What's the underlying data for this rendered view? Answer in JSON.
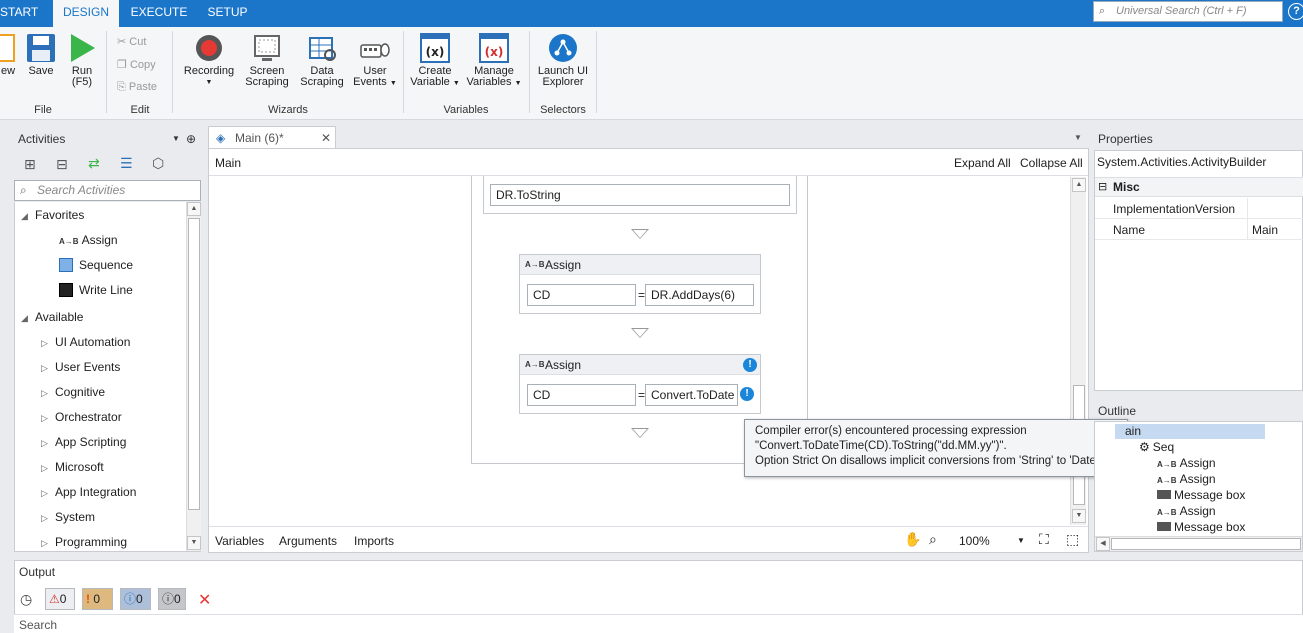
{
  "ribbon_tabs": [
    "START",
    "DESIGN",
    "EXECUTE",
    "SETUP"
  ],
  "universal_search": "Universal Search (Ctrl + F)",
  "ribbon": {
    "new_label": "ew",
    "save_label": "Save",
    "run_label": "Run",
    "run_shortcut": "(F5)",
    "file_group": "File",
    "cut": "Cut",
    "copy": "Copy",
    "paste": "Paste",
    "edit_group": "Edit",
    "recording": "Recording",
    "screen_scraping": [
      "Screen",
      "Scraping"
    ],
    "data_scraping": [
      "Data",
      "Scraping"
    ],
    "user_events": [
      "User",
      "Events"
    ],
    "wizards_group": "Wizards",
    "create_variable": [
      "Create",
      "Variable"
    ],
    "manage_variables": [
      "Manage",
      "Variables"
    ],
    "variables_group": "Variables",
    "launch_ui_explorer": [
      "Launch UI",
      "Explorer"
    ],
    "selectors_group": "Selectors"
  },
  "activities": {
    "title": "Activities",
    "search_placeholder": "Search Activities",
    "favorites_label": "Favorites",
    "favorites": [
      "Assign",
      "Sequence",
      "Write Line"
    ],
    "available_label": "Available",
    "available": [
      "UI Automation",
      "User Events",
      "Cognitive",
      "Orchestrator",
      "App Scripting",
      "Microsoft",
      "App Integration",
      "System",
      "Programming"
    ]
  },
  "designer": {
    "tab_title": "Main (6)*",
    "breadcrumb": "Main",
    "expand_all": "Expand All",
    "collapse_all": "Collapse All",
    "top_field": "DR.ToString",
    "assign1": {
      "title": "Assign",
      "to": "CD",
      "value": "DR.AddDays(6)"
    },
    "assign2": {
      "title": "Assign",
      "to": "CD",
      "value": "Convert.ToDate"
    },
    "equals": "=",
    "bottom_tabs": [
      "Variables",
      "Arguments",
      "Imports"
    ],
    "zoom": "100%"
  },
  "tooltip": {
    "line1": "Compiler error(s) encountered processing expression",
    "line2": "\"Convert.ToDateTime(CD).ToString(\"dd.MM.yy\")\".",
    "line3": "Option Strict On disallows implicit conversions from 'String' to 'Date'."
  },
  "properties": {
    "title": "Properties",
    "object": "System.Activities.ActivityBuilder",
    "category": "Misc",
    "rows": [
      {
        "name": "ImplementationVersion",
        "value": ""
      },
      {
        "name": "Name",
        "value": "Main"
      }
    ]
  },
  "outline": {
    "title": "Outline",
    "root": "ain",
    "seq": "Seq",
    "items": [
      "Assign",
      "Assign",
      "Message box",
      "Assign",
      "Message box"
    ]
  },
  "output": {
    "title": "Output",
    "errors": "0",
    "warnings": "0",
    "info": "0",
    "trace": "0",
    "search_placeholder": "Search"
  }
}
